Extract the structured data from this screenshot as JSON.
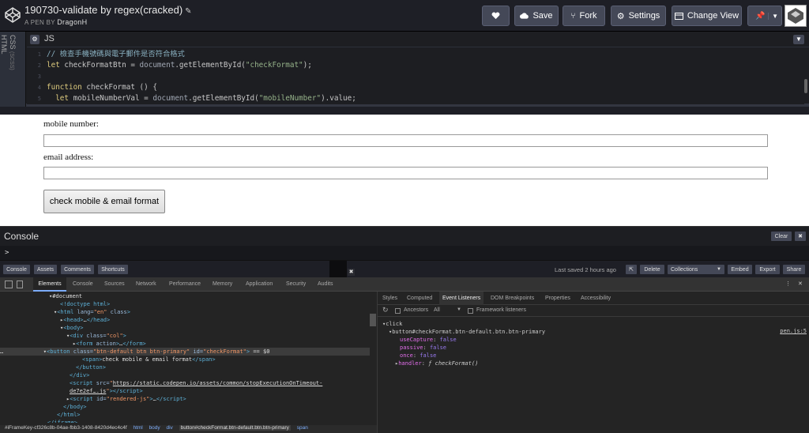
{
  "header": {
    "title": "190730-validate by regex(cracked)",
    "author_prefix": "A PEN BY",
    "author": "DragonH",
    "save": "Save",
    "fork": "Fork",
    "settings": "Settings",
    "change_view": "Change View"
  },
  "editor": {
    "side_tabs": [
      "HTML",
      "CSS",
      "(SCSS)"
    ],
    "label": "JS",
    "lines": [
      {
        "n": "1",
        "parts": [
          [
            "cm",
            "// 檢查手機號碼與電子郵件是否符合格式"
          ]
        ]
      },
      {
        "n": "2",
        "parts": [
          [
            "kw",
            "let "
          ],
          [
            "ct",
            "checkFormatBtn = "
          ],
          [
            "fn",
            "document"
          ],
          [
            "ct",
            ".getElementById("
          ],
          [
            "str",
            "\"checkFormat\""
          ],
          [
            "ct",
            ");"
          ]
        ]
      },
      {
        "n": "3",
        "parts": []
      },
      {
        "n": "4",
        "parts": [
          [
            "kw",
            "function "
          ],
          [
            "ct",
            "checkFormat () {"
          ]
        ]
      },
      {
        "n": "5",
        "parts": [
          [
            "kw",
            "  let "
          ],
          [
            "ct",
            "mobileNumberVal = "
          ],
          [
            "fn",
            "document"
          ],
          [
            "ct",
            ".getElementById("
          ],
          [
            "str",
            "\"mobileNumber\""
          ],
          [
            "ct",
            ").value;"
          ]
        ]
      }
    ]
  },
  "result": {
    "mobile_label": "mobile number:",
    "email_label": "email address:",
    "button": "check mobile & email format"
  },
  "console": {
    "title": "Console",
    "clear": "Clear",
    "close": "✖",
    "prompt": ">"
  },
  "footer": {
    "console": "Console",
    "assets": "Assets",
    "comments": "Comments",
    "shortcuts": "Shortcuts",
    "saved": "Last saved 2 hours ago",
    "delete": "Delete",
    "collections": "Collections",
    "embed": "Embed",
    "export": "Export",
    "share": "Share"
  },
  "devtools": {
    "tabs": [
      "Elements",
      "Console",
      "Sources",
      "Network",
      "Performance",
      "Memory",
      "Application",
      "Security",
      "Audits"
    ],
    "right_tabs": [
      "Styles",
      "Computed",
      "Event Listeners",
      "DOM Breakpoints",
      "Properties",
      "Accessibility"
    ],
    "ancestors": "Ancestors",
    "all": "All",
    "framework": "Framework listeners",
    "event": "click",
    "event_target": "button#checkFormat.btn-default.btn.btn-primary",
    "event_src": "pen.js:5",
    "use_capture": "false",
    "passive": "false",
    "once": "false",
    "handler": "ƒ checkFormat()",
    "crumbs": [
      "#iFrameKey-cf326c8b-04ae-fbb3-1408-8420d4ec4c4f",
      "html",
      "body",
      "div",
      "button#checkFormat.btn-default.btn.btn-primary",
      "span"
    ]
  }
}
